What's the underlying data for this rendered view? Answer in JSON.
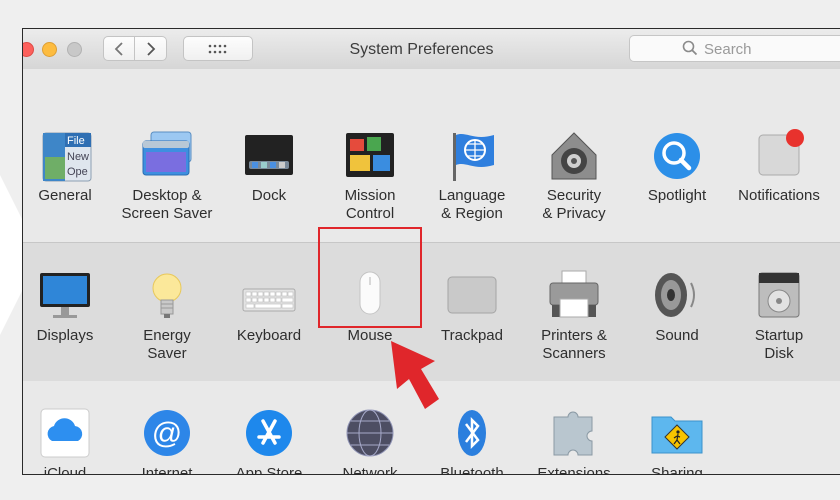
{
  "window": {
    "title": "System Preferences",
    "search_placeholder": "Search"
  },
  "row1": [
    {
      "label": "General"
    },
    {
      "label": "Desktop &\nScreen Saver"
    },
    {
      "label": "Dock"
    },
    {
      "label": "Mission\nControl"
    },
    {
      "label": "Language\n& Region"
    },
    {
      "label": "Security\n& Privacy"
    },
    {
      "label": "Spotlight"
    },
    {
      "label": "Notifications"
    }
  ],
  "row2": [
    {
      "label": "Displays"
    },
    {
      "label": "Energy\nSaver"
    },
    {
      "label": "Keyboard"
    },
    {
      "label": "Mouse"
    },
    {
      "label": "Trackpad"
    },
    {
      "label": "Printers &\nScanners"
    },
    {
      "label": "Sound"
    },
    {
      "label": "Startup\nDisk"
    }
  ],
  "row3": [
    {
      "label": "iCloud"
    },
    {
      "label": "Internet\nAccounts"
    },
    {
      "label": "App Store"
    },
    {
      "label": "Network"
    },
    {
      "label": "Bluetooth"
    },
    {
      "label": "Extensions"
    },
    {
      "label": "Sharing"
    }
  ],
  "general_icon_text": [
    "File",
    "New",
    "Ope"
  ],
  "colors": {
    "highlight": "#e0262b",
    "arrow": "#e0262b"
  }
}
